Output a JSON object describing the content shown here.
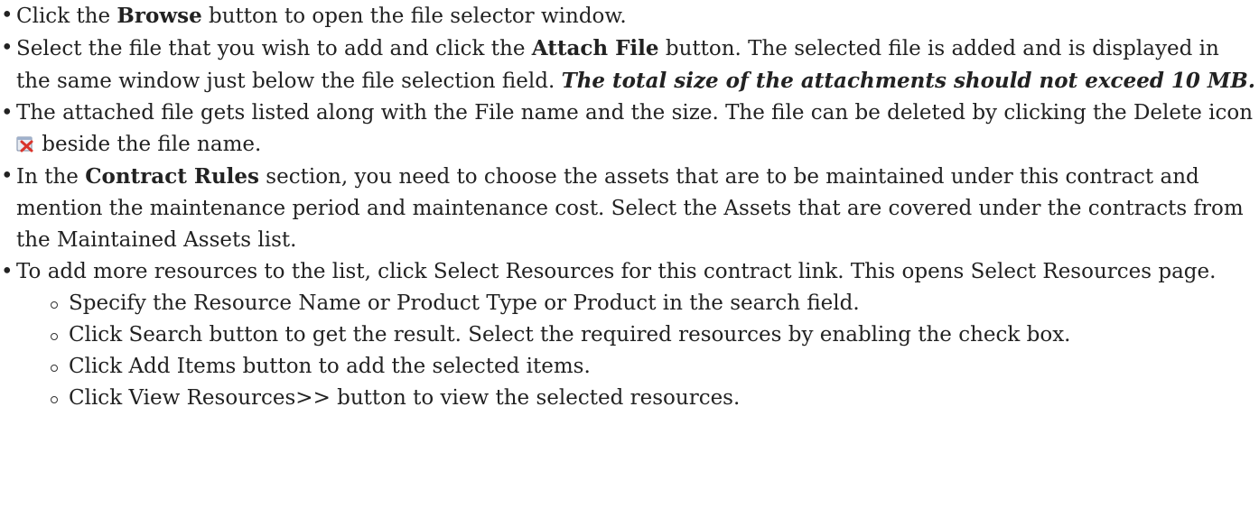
{
  "steps": [
    {
      "pre": "Click the ",
      "bold": "Browse",
      "post": " button to open the file selector window."
    },
    {
      "pre": "Select the file that you wish to add and click the ",
      "bold": "Attach File",
      "post": " button. The selected file is added and is displayed in the same window just below the file selection field. ",
      "emphasis": "The total size of the attachments should not exceed 10 MB."
    },
    {
      "pre": "The attached file gets listed along with the File name and the size. The file can be deleted by clicking the Delete icon",
      "icon": "delete-icon",
      "post": " beside the file name."
    },
    {
      "pre": "In the ",
      "bold": "Contract Rules",
      "post": " section, you need to choose the assets that are to be maintained under this contract and mention the maintenance period and maintenance cost. Select the Assets that are covered under the contracts from the Maintained Assets list."
    },
    {
      "text": "To add more resources to the list, click Select Resources for this contract link. This opens Select Resources page."
    }
  ],
  "substeps": [
    "Specify the Resource Name or Product Type or Product in the search field.",
    "Click Search button to get the result. Select the required resources by enabling the check box.",
    "Click Add Items button to add the selected items.",
    "Click View Resources>> button to view the selected resources."
  ],
  "colors": {
    "text": "#222222",
    "icon_red": "#d9342b",
    "icon_bg": "#e8ecf2"
  }
}
